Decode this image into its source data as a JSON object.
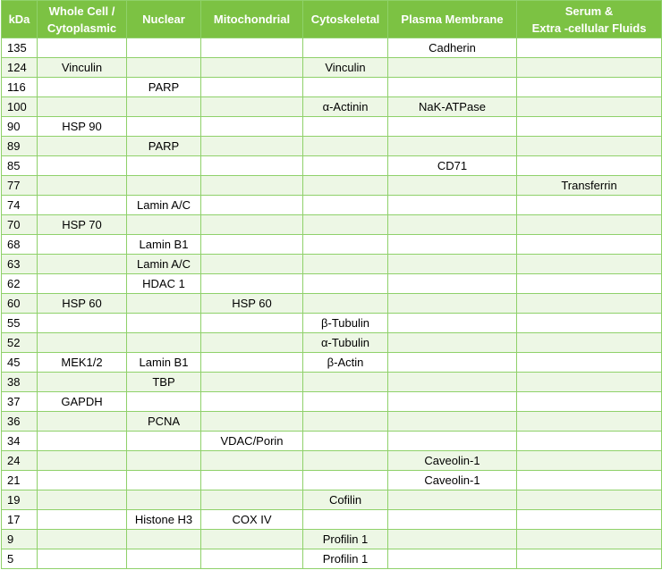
{
  "columns": [
    "kDa",
    "Whole Cell / Cytoplasmic",
    "Nuclear",
    "Mitochondrial",
    "Cytoskeletal",
    "Plasma Membrane",
    "Serum & Extra -cellular Fluids"
  ],
  "header_lines": [
    [
      "kDa"
    ],
    [
      "Whole Cell /",
      "Cytoplasmic"
    ],
    [
      "Nuclear"
    ],
    [
      "Mitochondrial"
    ],
    [
      "Cytoskeletal"
    ],
    [
      "Plasma Membrane"
    ],
    [
      "Serum &",
      "Extra -cellular Fluids"
    ]
  ],
  "rows": [
    [
      "135",
      "",
      "",
      "",
      "",
      "Cadherin",
      ""
    ],
    [
      "124",
      "Vinculin",
      "",
      "",
      "Vinculin",
      "",
      ""
    ],
    [
      "116",
      "",
      "PARP",
      "",
      "",
      "",
      ""
    ],
    [
      "100",
      "",
      "",
      "",
      "α-Actinin",
      "NaK-ATPase",
      ""
    ],
    [
      "90",
      "HSP 90",
      "",
      "",
      "",
      "",
      ""
    ],
    [
      "89",
      "",
      "PARP",
      "",
      "",
      "",
      ""
    ],
    [
      "85",
      "",
      "",
      "",
      "",
      "CD71",
      ""
    ],
    [
      "77",
      "",
      "",
      "",
      "",
      "",
      "Transferrin"
    ],
    [
      "74",
      "",
      "Lamin A/C",
      "",
      "",
      "",
      ""
    ],
    [
      "70",
      "HSP 70",
      "",
      "",
      "",
      "",
      ""
    ],
    [
      "68",
      "",
      "Lamin B1",
      "",
      "",
      "",
      ""
    ],
    [
      "63",
      "",
      "Lamin A/C",
      "",
      "",
      "",
      ""
    ],
    [
      "62",
      "",
      "HDAC 1",
      "",
      "",
      "",
      ""
    ],
    [
      "60",
      "HSP 60",
      "",
      "HSP 60",
      "",
      "",
      ""
    ],
    [
      "55",
      "",
      "",
      "",
      "β-Tubulin",
      "",
      ""
    ],
    [
      "52",
      "",
      "",
      "",
      "α-Tubulin",
      "",
      ""
    ],
    [
      "45",
      "MEK1/2",
      "Lamin B1",
      "",
      "β-Actin",
      "",
      ""
    ],
    [
      "38",
      "",
      "TBP",
      "",
      "",
      "",
      ""
    ],
    [
      "37",
      "GAPDH",
      "",
      "",
      "",
      "",
      ""
    ],
    [
      "36",
      "",
      "PCNA",
      "",
      "",
      "",
      ""
    ],
    [
      "34",
      "",
      "",
      "VDAC/Porin",
      "",
      "",
      ""
    ],
    [
      "24",
      "",
      "",
      "",
      "",
      "Caveolin-1",
      ""
    ],
    [
      "21",
      "",
      "",
      "",
      "",
      "Caveolin-1",
      ""
    ],
    [
      "19",
      "",
      "",
      "",
      "Cofilin",
      "",
      ""
    ],
    [
      "17",
      "",
      "Histone H3",
      "COX IV",
      "",
      "",
      ""
    ],
    [
      "9",
      "",
      "",
      "",
      "Profilin 1",
      "",
      ""
    ],
    [
      "5",
      "",
      "",
      "",
      "Profilin 1",
      "",
      ""
    ]
  ],
  "colors": {
    "header_bg": "#7cc243",
    "header_text": "#ffffff",
    "grid_line": "#8fd16a",
    "stripe": "#edf7e5"
  }
}
